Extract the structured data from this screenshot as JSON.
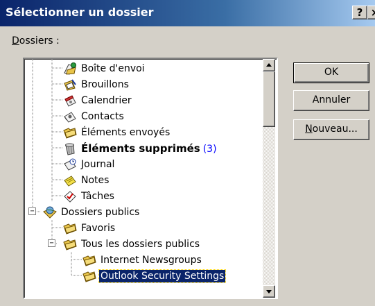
{
  "dialog": {
    "title": "Sélectionner un dossier",
    "help_glyph": "?",
    "close_glyph": "×"
  },
  "label": {
    "prefix": "D",
    "rest": "ossiers :"
  },
  "buttons": {
    "ok": "OK",
    "cancel": "Annuler",
    "new_prefix": "N",
    "new_rest": "ouveau..."
  },
  "tree": {
    "items": [
      {
        "label": "Boîte d'envoi",
        "icon": "outbox-icon"
      },
      {
        "label": "Brouillons",
        "icon": "drafts-icon"
      },
      {
        "label": "Calendrier",
        "icon": "calendar-icon"
      },
      {
        "label": "Contacts",
        "icon": "contacts-icon"
      },
      {
        "label": "Éléments envoyés",
        "icon": "folder-icon"
      },
      {
        "label": "Éléments supprimés",
        "count": "(3)",
        "icon": "trash-icon",
        "bold": true
      },
      {
        "label": "Journal",
        "icon": "journal-icon"
      },
      {
        "label": "Notes",
        "icon": "notes-icon"
      },
      {
        "label": "Tâches",
        "icon": "tasks-icon"
      },
      {
        "label": "Dossiers publics",
        "icon": "public-folders-icon",
        "expander": "−"
      },
      {
        "label": "Favoris",
        "icon": "folder-icon"
      },
      {
        "label": "Tous les dossiers publics",
        "icon": "folder-icon",
        "expander": "−"
      },
      {
        "label": "Internet Newsgroups",
        "icon": "folder-icon"
      },
      {
        "label": "Outlook Security Settings",
        "icon": "folder-icon",
        "selected": true
      }
    ]
  },
  "scrollbar": {
    "position": 0.0
  },
  "colors": {
    "title_bar": "#0a246a",
    "selection": "#0a246a",
    "dialog_bg": "#d4d0c8",
    "count_color": "#0000ff"
  }
}
